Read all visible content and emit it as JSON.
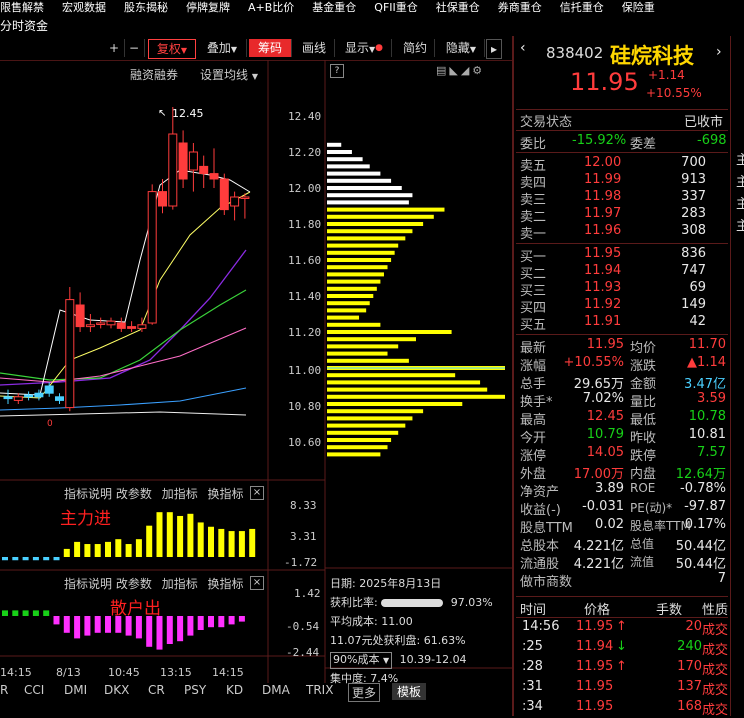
{
  "topbar": {
    "items": [
      "限售解禁",
      "宏观数据",
      "股东揭秘",
      "停牌复牌",
      "A+B比价",
      "基金重仓",
      "QFII重仓",
      "社保重仓",
      "券商重仓",
      "信托重仓",
      "保险重"
    ]
  },
  "subbar": {
    "label": "分时资金"
  },
  "toolbar": {
    "plus": "+",
    "minus": "−",
    "menu": "☰",
    "fuquan": "复权",
    "diejia": "叠加",
    "chouma": "筹码",
    "huaxian": "画线",
    "xianshi": "显示",
    "jianyue": "简约",
    "yincang": "隐藏",
    "more": "▸"
  },
  "chart_header": {
    "rzrq": "融资融券",
    "shezhi": "设置均线"
  },
  "price_axis": [
    "12.40",
    "12.20",
    "12.00",
    "11.80",
    "11.60",
    "11.40",
    "11.20",
    "11.00",
    "10.80",
    "10.60"
  ],
  "high_label": "12.45",
  "indicator1": {
    "tools": [
      "指标说明",
      "改参数",
      "加指标",
      "换指标"
    ],
    "title": "主力进",
    "axis": [
      "8.33",
      "3.31",
      "-1.72"
    ]
  },
  "indicator2": {
    "tools": [
      "指标说明",
      "改参数",
      "加指标",
      "换指标"
    ],
    "title": "散户出",
    "axis": [
      "1.42",
      "-0.54",
      "-2.44"
    ]
  },
  "time_axis": [
    "14:15",
    "8/13",
    "10:45",
    "13:15",
    "14:15"
  ],
  "chip_panel": {
    "date": "日期: 2025年8月13日",
    "profit_ratio_label": "获利比率:",
    "profit_ratio": "97.03%",
    "avg_cost": "平均成本: 11.00",
    "chip_profit": "11.07元处获利盘: 61.63%",
    "cost_select": "90%成本",
    "cost_range": "10.39-12.04",
    "concentration": "集中度: 7.4%"
  },
  "bottom_tabs": [
    "R",
    "CCI",
    "DMI",
    "DKX",
    "CR",
    "PSY",
    "KD",
    "DMA",
    "TRIX",
    "更多",
    "模板"
  ],
  "stock": {
    "code": "838402",
    "name": "硅烷科技",
    "price": "11.95",
    "change": "+1.14",
    "pct": "+10.55%"
  },
  "status": {
    "label": "交易状态",
    "value": "已收市"
  },
  "weibi": {
    "l1": "委比",
    "v1": "-15.92%",
    "l2": "委差",
    "v2": "-698"
  },
  "sells": [
    {
      "label": "卖五",
      "price": "12.00",
      "vol": "700"
    },
    {
      "label": "卖四",
      "price": "11.99",
      "vol": "913"
    },
    {
      "label": "卖三",
      "price": "11.98",
      "vol": "337"
    },
    {
      "label": "卖二",
      "price": "11.97",
      "vol": "283"
    },
    {
      "label": "卖一",
      "price": "11.96",
      "vol": "308"
    }
  ],
  "buys": [
    {
      "label": "买一",
      "price": "11.95",
      "vol": "836"
    },
    {
      "label": "买二",
      "price": "11.94",
      "vol": "747"
    },
    {
      "label": "买三",
      "price": "11.93",
      "vol": "69"
    },
    {
      "label": "买四",
      "price": "11.92",
      "vol": "149"
    },
    {
      "label": "买五",
      "price": "11.91",
      "vol": "42"
    }
  ],
  "stats": [
    {
      "l1": "最新",
      "v1": "11.95",
      "c1": "red",
      "l2": "均价",
      "v2": "11.70",
      "c2": "red"
    },
    {
      "l1": "涨幅",
      "v1": "+10.55%",
      "c1": "red",
      "l2": "涨跌",
      "v2": "▲1.14",
      "c2": "red"
    },
    {
      "l1": "总手",
      "v1": "29.65万",
      "c1": "wht",
      "l2": "金额",
      "v2": "3.47亿",
      "c2": "cyan"
    },
    {
      "l1": "换手*",
      "v1": "7.02%",
      "c1": "wht",
      "l2": "量比",
      "v2": "3.59",
      "c2": "red"
    },
    {
      "l1": "最高",
      "v1": "12.45",
      "c1": "red",
      "l2": "最低",
      "v2": "10.78",
      "c2": "grn"
    },
    {
      "l1": "今开",
      "v1": "10.79",
      "c1": "grn",
      "l2": "昨收",
      "v2": "10.81",
      "c2": "wht"
    },
    {
      "l1": "涨停",
      "v1": "14.05",
      "c1": "red",
      "l2": "跌停",
      "v2": "7.57",
      "c2": "grn"
    },
    {
      "l1": "外盘",
      "v1": "17.00万",
      "c1": "red",
      "l2": "内盘",
      "v2": "12.64万",
      "c2": "grn"
    }
  ],
  "fund": [
    {
      "l1": "净资产",
      "v1": "3.89",
      "l2": "ROE",
      "v2": "-0.78%"
    },
    {
      "l1": "收益(-)",
      "v1": "-0.031",
      "l2": "PE(动)*",
      "v2": "-97.87"
    },
    {
      "l1": "股息TTM",
      "v1": "0.02",
      "l2": "股息率TTM",
      "v2": "0.17%"
    },
    {
      "l1": "总股本",
      "v1": "4.221亿",
      "l2": "总值",
      "v2": "50.44亿"
    },
    {
      "l1": "流通股",
      "v1": "4.221亿",
      "l2": "流值",
      "v2": "50.44亿"
    },
    {
      "l1": "做市商数",
      "v1": "",
      "l2": "",
      "v2": "7"
    }
  ],
  "trade_header": {
    "time": "时间",
    "price": "价格",
    "vol": "手数",
    "type": "性质"
  },
  "trades": [
    {
      "time": "14:56",
      "price": "11.95",
      "arrow": "↑",
      "ac": "red",
      "vol": "20",
      "vc": "red",
      "type": "成交"
    },
    {
      "time": ":25",
      "price": "11.94",
      "arrow": "↓",
      "ac": "grn",
      "vol": "240",
      "vc": "grn",
      "type": "成交"
    },
    {
      "time": ":28",
      "price": "11.95",
      "arrow": "↑",
      "ac": "red",
      "vol": "170",
      "vc": "red",
      "type": "成交"
    },
    {
      "time": ":31",
      "price": "11.95",
      "arrow": "",
      "ac": "red",
      "vol": "137",
      "vc": "red",
      "type": "成交"
    },
    {
      "time": ":34",
      "price": "11.95",
      "arrow": "",
      "ac": "red",
      "vol": "168",
      "vc": "red",
      "type": "成交"
    }
  ],
  "colors": {
    "up": "#ff3c3c",
    "down": "#18d018",
    "chip": "#ffff00",
    "bg": "#000000"
  }
}
